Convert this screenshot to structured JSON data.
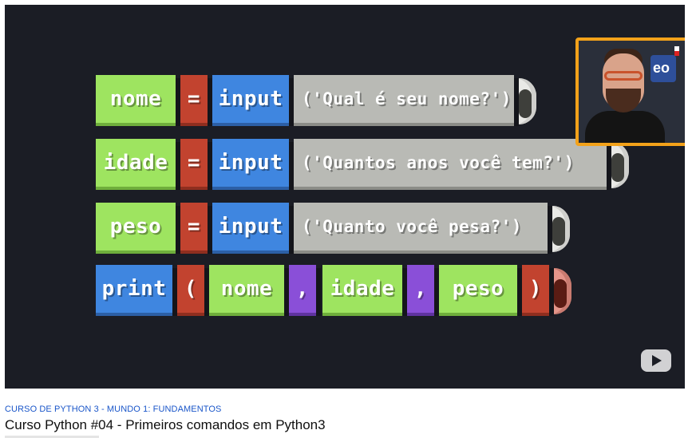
{
  "video": {
    "rows": [
      {
        "tokens": [
          {
            "text": "nome",
            "color": "green"
          },
          {
            "text": "=",
            "color": "red"
          },
          {
            "text": "input",
            "color": "blue"
          },
          {
            "text": "('Qual é seu nome?')",
            "color": "gray"
          }
        ]
      },
      {
        "tokens": [
          {
            "text": "idade",
            "color": "green"
          },
          {
            "text": "=",
            "color": "red"
          },
          {
            "text": "input",
            "color": "blue"
          },
          {
            "text": "('Quantos anos você tem?')",
            "color": "gray"
          }
        ]
      },
      {
        "tokens": [
          {
            "text": "peso",
            "color": "green"
          },
          {
            "text": "=",
            "color": "red"
          },
          {
            "text": "input",
            "color": "blue"
          },
          {
            "text": "('Quanto você pesa?')",
            "color": "gray"
          }
        ]
      },
      {
        "tokens": [
          {
            "text": "print",
            "color": "blue"
          },
          {
            "text": "(",
            "color": "red"
          },
          {
            "text": "nome",
            "color": "green"
          },
          {
            "text": ",",
            "color": "purple"
          },
          {
            "text": "idade",
            "color": "green"
          },
          {
            "text": ",",
            "color": "purple"
          },
          {
            "text": "peso",
            "color": "green"
          },
          {
            "text": ")",
            "color": "red"
          }
        ]
      }
    ],
    "webcam_logo_text": "eo",
    "overlay_icon": "youtube-play-icon"
  },
  "meta": {
    "course_link": "CURSO DE PYTHON 3 - MUNDO 1: FUNDAMENTOS",
    "title": "Curso Python #04 - Primeiros comandos em Python3"
  },
  "colors": {
    "green": "#9ee460",
    "red": "#c2432f",
    "blue": "#3f86e0",
    "gray": "#b9bab5",
    "purple": "#8a4fd8",
    "border": "#f3a21a",
    "link": "#1a56c9"
  }
}
